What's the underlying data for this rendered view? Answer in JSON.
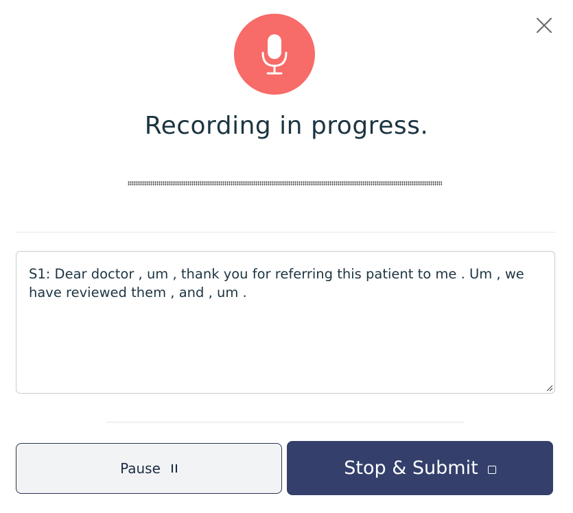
{
  "dialog": {
    "title": "Recording in progress."
  },
  "transcript": {
    "text": "S1: Dear doctor , um , thank you for referring this patient to me . Um , we have reviewed them , and , um ."
  },
  "buttons": {
    "pause_label": "Pause",
    "submit_label": "Stop & Submit"
  },
  "colors": {
    "mic_accent": "#f76b68",
    "primary_button": "#34406b",
    "text": "#1c3441"
  },
  "icons": {
    "close": "close-icon",
    "mic": "microphone-icon",
    "pause": "pause-icon",
    "stop": "stop-icon"
  }
}
